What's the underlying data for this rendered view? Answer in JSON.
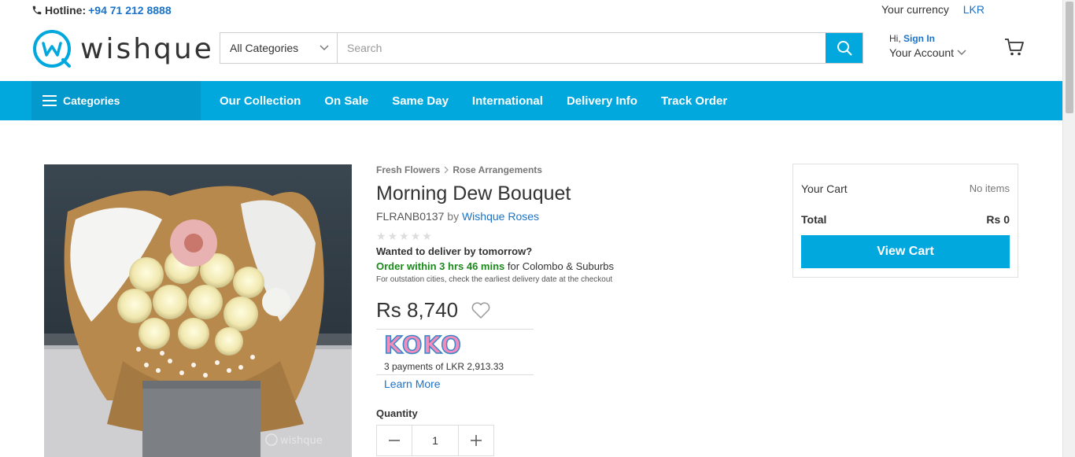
{
  "topbar": {
    "hotline_label": "Hotline:",
    "hotline_number": "+94 71 212 8888",
    "currency_label": "Your currency",
    "currency_value": "LKR"
  },
  "header": {
    "logo_text": "wishque",
    "category_select": "All Categories",
    "search_placeholder": "Search",
    "greeting": "Hi,",
    "sign_in": "Sign In",
    "account_label": "Your Account"
  },
  "nav": {
    "categories_label": "Categories",
    "links": [
      "Our Collection",
      "On Sale",
      "Same Day",
      "International",
      "Delivery Info",
      "Track Order"
    ]
  },
  "product": {
    "breadcrumb": [
      "Fresh Flowers",
      "Rose Arrangements"
    ],
    "title": "Morning Dew Bouquet",
    "sku": "FLRANB0137",
    "by_label": "by",
    "brand": "Wishque Roses",
    "rating": 0,
    "wanted": "Wanted to deliver by tomorrow?",
    "order_within": "Order within 3 hrs 46 mins",
    "order_area": "for Colombo & Suburbs",
    "outstation_note": "For outstation cities, check the earliest delivery date at the checkout",
    "price": "Rs 8,740",
    "koko_logo": "KOKO",
    "koko_payments": "3 payments of LKR 2,913.33",
    "learn_more": "Learn More",
    "quantity_label": "Quantity",
    "quantity_value": "1",
    "image_watermark": "wishque"
  },
  "cart": {
    "title": "Your Cart",
    "items_status": "No items",
    "total_label": "Total",
    "total_value": "Rs 0",
    "view_cart": "View Cart"
  },
  "colors": {
    "brand_blue": "#00a8de",
    "link_blue": "#1a73c9",
    "order_green": "#1b8a1b"
  }
}
